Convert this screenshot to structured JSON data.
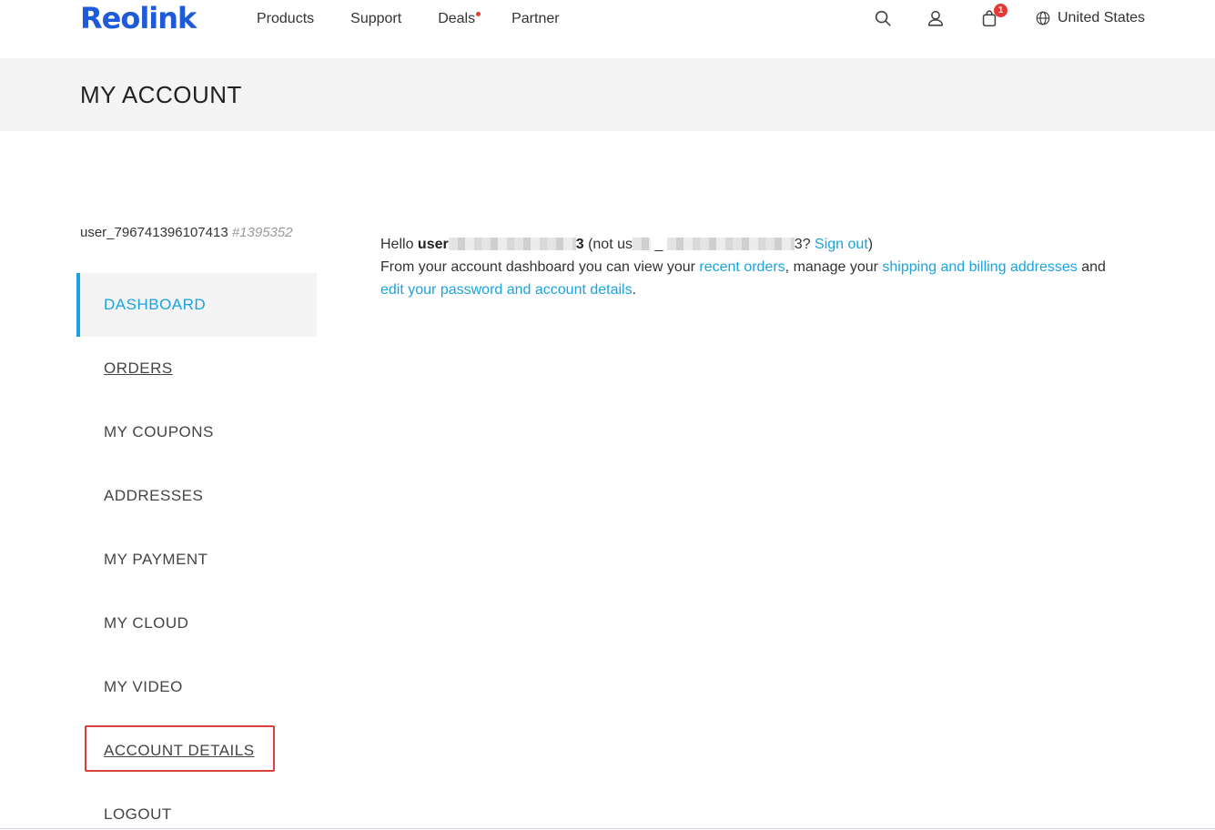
{
  "header": {
    "logo": "Reolink",
    "nav": [
      {
        "label": "Products"
      },
      {
        "label": "Support"
      },
      {
        "label": "Deals",
        "dot": true
      },
      {
        "label": "Partner"
      }
    ],
    "icons": [
      "search-icon",
      "user-icon",
      "cart-icon",
      "globe-icon"
    ],
    "cart_count": "1",
    "region": "United States"
  },
  "title_bar": {
    "title": "MY ACCOUNT"
  },
  "sidebar": {
    "username": "user_796741396107413",
    "user_number": "#1395352",
    "items": [
      {
        "label": "DASHBOARD",
        "active": true
      },
      {
        "label": "ORDERS",
        "underline": true
      },
      {
        "label": "MY COUPONS"
      },
      {
        "label": "ADDRESSES"
      },
      {
        "label": "MY PAYMENT"
      },
      {
        "label": "MY CLOUD"
      },
      {
        "label": "MY VIDEO"
      },
      {
        "label": "ACCOUNT DETAILS",
        "underline": true,
        "highlighted": true
      },
      {
        "label": "LOGOUT"
      }
    ]
  },
  "main": {
    "hello": "Hello",
    "user_prefix": "user",
    "user_suffix": "3",
    "not_prefix": "(not us",
    "not_suffix": "3?",
    "sign_out": "Sign out",
    "close_paren": ")",
    "dashboard_text_1": "From your account dashboard you can view your",
    "recent_orders": "recent orders",
    "dashboard_text_2": ", manage your",
    "addresses_link": "shipping and billing addresses",
    "dashboard_text_3": "and",
    "account_link": "edit your password and account details",
    "period": "."
  },
  "colors": {
    "brand": "#1f5bd8",
    "accent": "#1aa3e0",
    "highlight": "#d9403a",
    "badge": "#e53935"
  }
}
